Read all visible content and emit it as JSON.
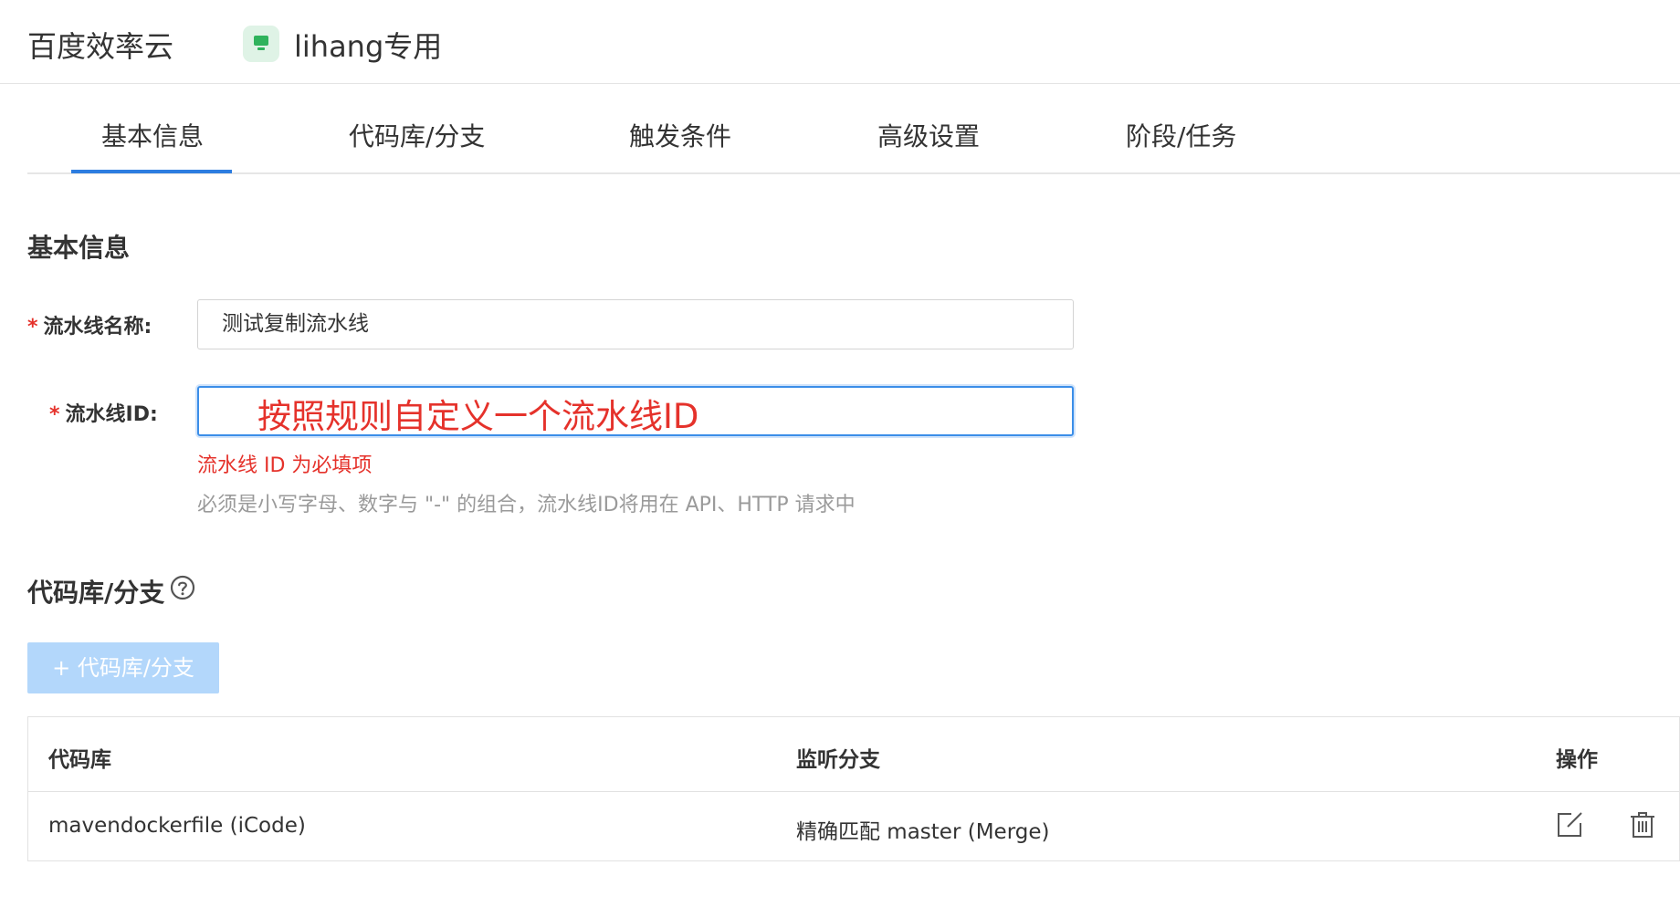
{
  "header": {
    "brand": "百度效率云",
    "workspace_name": "lihang专用"
  },
  "tabs": [
    {
      "label": "基本信息",
      "active": true
    },
    {
      "label": "代码库/分支",
      "active": false
    },
    {
      "label": "触发条件",
      "active": false
    },
    {
      "label": "高级设置",
      "active": false
    },
    {
      "label": "阶段/任务",
      "active": false
    }
  ],
  "basic_info": {
    "title": "基本信息",
    "name_field": {
      "required_mark": "*",
      "label": "流水线名称:",
      "value": "测试复制流水线"
    },
    "id_field": {
      "required_mark": "*",
      "label": "流水线ID:",
      "value": "",
      "annotation": "按照规则自定义一个流水线ID",
      "error": "流水线 ID 为必填项",
      "hint": "必须是小写字母、数字与 \"-\" 的组合，流水线ID将用在 API、HTTP 请求中"
    }
  },
  "repo_section": {
    "title": "代码库/分支",
    "help_icon": "question-circle-icon",
    "add_button_label": "+ 代码库/分支",
    "table": {
      "headers": [
        "代码库",
        "监听分支",
        "操作"
      ],
      "rows": [
        {
          "repo": "mavendockerfile (iCode)",
          "branch": "精确匹配 master (Merge)"
        }
      ]
    }
  },
  "colors": {
    "accent": "#2d7de0",
    "error": "#e5322b",
    "disabled_button": "#b3d7fb",
    "workspace_icon": "#2fb35c"
  }
}
